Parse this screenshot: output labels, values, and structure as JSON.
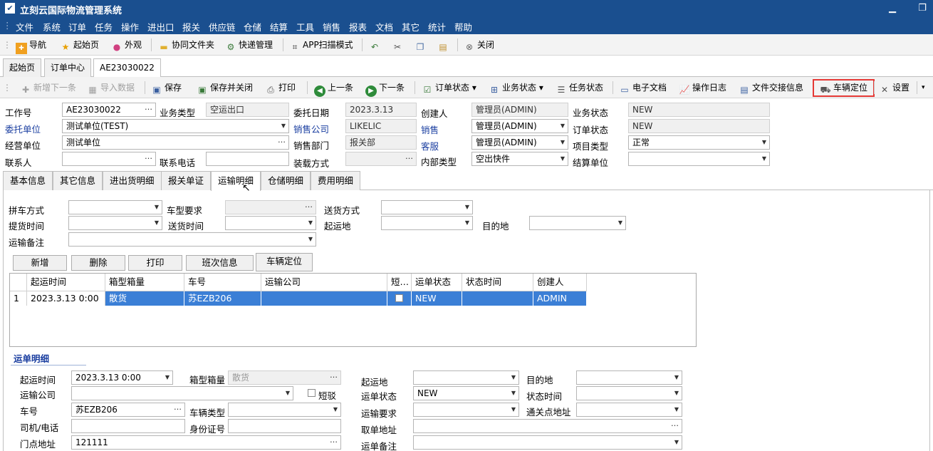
{
  "app": {
    "title": "立刻云国际物流管理系统",
    "logo": "bird-logo"
  },
  "menu": [
    "文件",
    "系统",
    "订单",
    "任务",
    "操作",
    "进出口",
    "报关",
    "供应链",
    "仓储",
    "结算",
    "工具",
    "销售",
    "报表",
    "文档",
    "其它",
    "统计",
    "帮助"
  ],
  "toolbar": {
    "nav": "导航",
    "home": "起始页",
    "skin": "外观",
    "share_folder": "协同文件夹",
    "express": "快递管理",
    "app_scan": "APP扫描模式",
    "close": "关闭"
  },
  "doc_tabs": [
    "起始页",
    "订单中心",
    "AE23030022"
  ],
  "actions": {
    "add_next": "新增下一条",
    "import": "导入数据",
    "save": "保存",
    "save_close": "保存并关闭",
    "print": "打印",
    "prev": "上一条",
    "next": "下一条",
    "order_status": "订单状态",
    "biz_status": "业务状态",
    "task_status": "任务状态",
    "edoc": "电子文档",
    "oplog": "操作日志",
    "file_handover": "文件交接信息",
    "vehicle_locate": "车辆定位",
    "settings": "设置"
  },
  "header": {
    "job_no": {
      "label": "工作号",
      "value": "AE23030022"
    },
    "biz_type": {
      "label": "业务类型",
      "value": "空运出口"
    },
    "entrust_date": {
      "label": "委托日期",
      "value": "2023.3.13"
    },
    "creator": {
      "label": "创建人",
      "value": "管理员(ADMIN)"
    },
    "biz_status": {
      "label": "业务状态",
      "value": "NEW"
    },
    "client": {
      "label": "委托单位",
      "value": "测试单位(TEST)"
    },
    "sales_company": {
      "label": "销售公司",
      "value": "LIKELIC"
    },
    "sales": {
      "label": "销售",
      "value": "管理员(ADMIN)"
    },
    "order_status": {
      "label": "订单状态",
      "value": "NEW"
    },
    "operating_unit": {
      "label": "经营单位",
      "value": "测试单位"
    },
    "sales_dept": {
      "label": "销售部门",
      "value": "报关部"
    },
    "cs": {
      "label": "客服",
      "value": "管理员(ADMIN)"
    },
    "project_type": {
      "label": "项目类型",
      "value": "正常"
    },
    "contact": {
      "label": "联系人",
      "value": ""
    },
    "phone": {
      "label": "联系电话",
      "value": ""
    },
    "load_mode": {
      "label": "装载方式",
      "value": ""
    },
    "inner_type": {
      "label": "内部类型",
      "value": "空出快件"
    },
    "settle_unit": {
      "label": "结算单位",
      "value": ""
    }
  },
  "sub_tabs": [
    "基本信息",
    "其它信息",
    "进出货明细",
    "报关单证",
    "运输明细",
    "仓储明细",
    "费用明细"
  ],
  "transport": {
    "pool_mode": "拼车方式",
    "vehicle_req": "车型要求",
    "deliver_mode": "送货方式",
    "pickup_time": "提货时间",
    "deliver_time": "送货时间",
    "origin": "起运地",
    "destination": "目的地",
    "remark": "运输备注"
  },
  "grid_buttons": [
    "新增",
    "删除",
    "打印",
    "班次信息",
    "车辆定位"
  ],
  "grid": {
    "columns": [
      "起运时间",
      "箱型箱量",
      "车号",
      "运输公司",
      "短…",
      "运单状态",
      "状态时间",
      "创建人"
    ],
    "rows": [
      {
        "idx": "1",
        "time": "2023.3.13 0:00",
        "box": "散货",
        "plate": "苏EZB206",
        "company": "",
        "short": "",
        "status": "NEW",
        "status_time": "",
        "creator": "ADMIN"
      }
    ]
  },
  "detail": {
    "section": "运单明细",
    "start_time": {
      "label": "起运时间",
      "value": "2023.3.13 0:00"
    },
    "box": {
      "label": "箱型箱量",
      "value": "散货"
    },
    "origin": {
      "label": "起运地",
      "value": ""
    },
    "destination": {
      "label": "目的地",
      "value": ""
    },
    "company": {
      "label": "运输公司",
      "value": ""
    },
    "short_check": "短驳",
    "status": {
      "label": "运单状态",
      "value": "NEW"
    },
    "status_time": {
      "label": "状态时间",
      "value": ""
    },
    "plate": {
      "label": "车号",
      "value": "苏EZB206"
    },
    "vehicle_type": {
      "label": "车辆类型",
      "value": ""
    },
    "req": {
      "label": "运输要求",
      "value": ""
    },
    "customs_addr": {
      "label": "通关点地址",
      "value": ""
    },
    "driver": {
      "label": "司机/电话",
      "value": ""
    },
    "id_no": {
      "label": "身份证号",
      "value": ""
    },
    "pickup_addr": {
      "label": "取单地址",
      "value": ""
    },
    "door_addr": {
      "label": "门点地址",
      "value": "121111"
    },
    "remark": {
      "label": "运单备注",
      "value": ""
    }
  }
}
